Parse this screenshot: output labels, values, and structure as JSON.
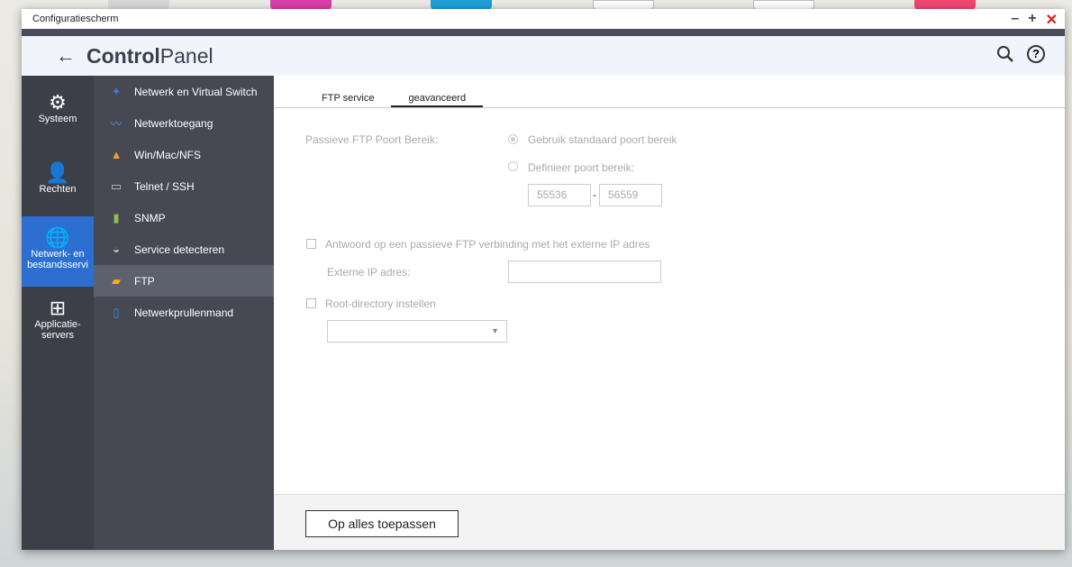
{
  "window": {
    "title": "Configuratiescherm"
  },
  "header": {
    "back": "←",
    "logo_bold": "Control",
    "logo_light": "Panel",
    "help": "?"
  },
  "side1": [
    {
      "label": "Systeem",
      "icon": "⚙"
    },
    {
      "label": "Rechten",
      "icon": "👤"
    },
    {
      "label": "Netwerk- en bestandsservi",
      "icon": "🌐"
    },
    {
      "label": "Applicatie-servers",
      "icon": "⊞"
    }
  ],
  "side2": [
    {
      "label": "Netwerk en Virtual Switch",
      "icon": "✦",
      "color": "#3a7be0"
    },
    {
      "label": "Netwerktoegang",
      "icon": "〰",
      "color": "#4aa0e8"
    },
    {
      "label": "Win/Mac/NFS",
      "icon": "▲",
      "color": "#e8a030"
    },
    {
      "label": "Telnet / SSH",
      "icon": "▭",
      "color": "#ccc"
    },
    {
      "label": "SNMP",
      "icon": "▮",
      "color": "#8bc34a"
    },
    {
      "label": "Service detecteren",
      "icon": "◒",
      "color": "#bbb"
    },
    {
      "label": "FTP",
      "icon": "▰",
      "color": "#f5b400"
    },
    {
      "label": "Netwerkprullenmand",
      "icon": "▯",
      "color": "#3a8fe0"
    }
  ],
  "tabs": [
    "FTP service",
    "geavanceerd"
  ],
  "form": {
    "passive_label": "Passieve FTP Poort Bereik:",
    "radio_default": "Gebruik standaard poort bereik",
    "radio_define": "Definieer poort bereik:",
    "port_from": "55536",
    "port_sep": "-",
    "port_to": "56559",
    "external_cb": "Antwoord op een passieve FTP verbinding met het externe IP adres",
    "external_ip_label": "Externe IP adres:",
    "external_ip": "",
    "root_cb": "Root-directory instellen",
    "root_select": ""
  },
  "footer": {
    "apply": "Op alles toepassen"
  }
}
